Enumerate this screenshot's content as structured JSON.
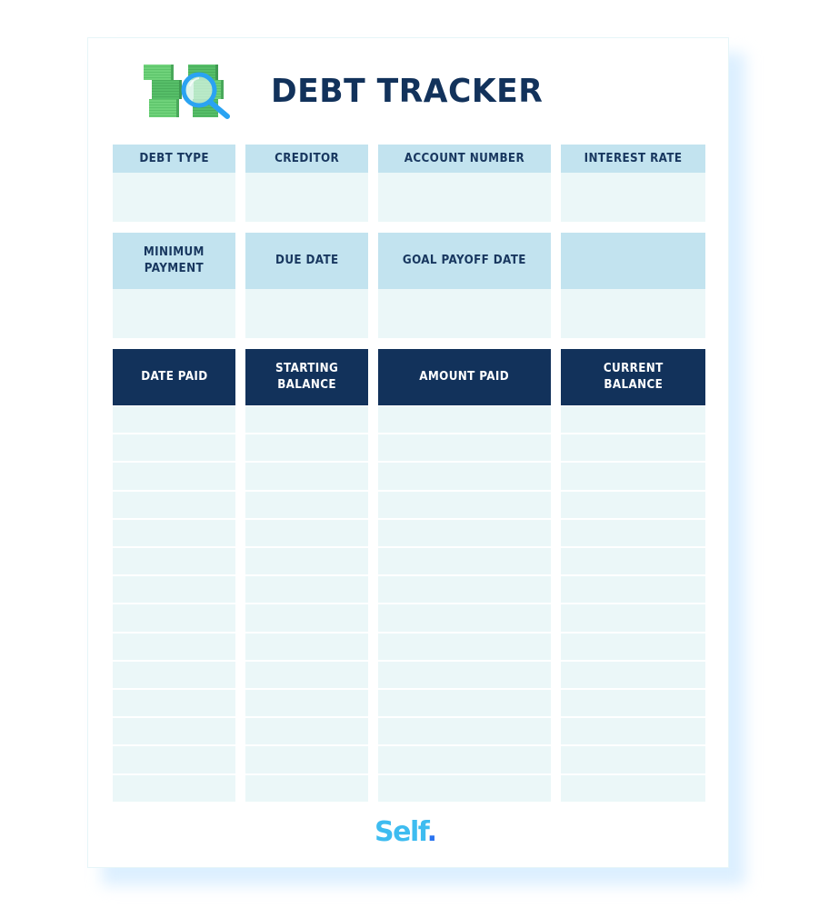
{
  "document": {
    "title": "DEBT TRACKER",
    "logo_icon": "money-magnifier-icon",
    "brand": {
      "name": "Self",
      "dot": "."
    },
    "colors": {
      "title": "#12325b",
      "light_header": "#c2e3ef",
      "dark_header": "#12325b",
      "cell": "#ebf7f8",
      "brand": "#3ebcf0",
      "brand_dot": "#2a73f0"
    }
  },
  "sections": {
    "details_1": {
      "headers": [
        "DEBT TYPE",
        "CREDITOR",
        "ACCOUNT NUMBER",
        "INTEREST RATE"
      ],
      "values": [
        "",
        "",
        "",
        ""
      ]
    },
    "details_2": {
      "headers": [
        "MINIMUM\nPAYMENT",
        "DUE DATE",
        "GOAL PAYOFF DATE",
        ""
      ],
      "values": [
        "",
        "",
        "",
        ""
      ]
    },
    "payment_log": {
      "headers": [
        "DATE PAID",
        "STARTING\nBALANCE",
        "AMOUNT PAID",
        "CURRENT\nBALANCE"
      ],
      "row_count": 14,
      "rows": [
        [
          "",
          "",
          "",
          ""
        ],
        [
          "",
          "",
          "",
          ""
        ],
        [
          "",
          "",
          "",
          ""
        ],
        [
          "",
          "",
          "",
          ""
        ],
        [
          "",
          "",
          "",
          ""
        ],
        [
          "",
          "",
          "",
          ""
        ],
        [
          "",
          "",
          "",
          ""
        ],
        [
          "",
          "",
          "",
          ""
        ],
        [
          "",
          "",
          "",
          ""
        ],
        [
          "",
          "",
          "",
          ""
        ],
        [
          "",
          "",
          "",
          ""
        ],
        [
          "",
          "",
          "",
          ""
        ],
        [
          "",
          "",
          "",
          ""
        ],
        [
          "",
          "",
          "",
          ""
        ]
      ]
    }
  }
}
